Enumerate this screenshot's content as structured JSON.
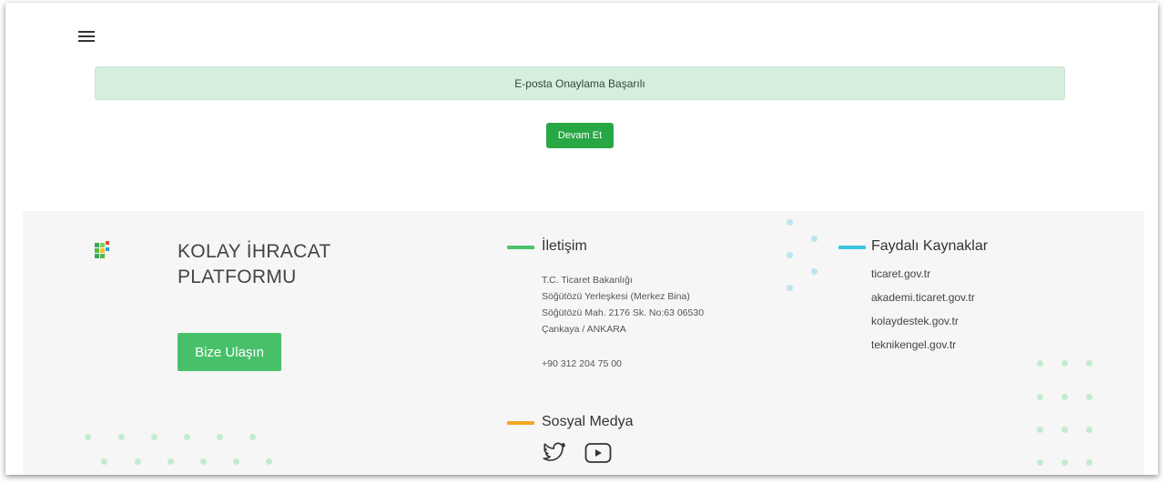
{
  "header": {
    "menu_icon": "hamburger-menu-icon"
  },
  "alert": {
    "text": "E-posta Onaylama Başarılı"
  },
  "continue_button": {
    "label": "Devam Et"
  },
  "footer": {
    "brand": {
      "line1": "KOLAY İHRACAT",
      "line2": "PLATFORMU",
      "logo_icon": "pixel-logo-icon"
    },
    "contact_button": {
      "label": "Bize Ulaşın"
    },
    "contact": {
      "title": "İletişim",
      "address_lines": [
        "T.C. Ticaret Bakanlığı",
        "Söğütözü Yerleşkesi (Merkez Bina)",
        "Söğütözü Mah. 2176 Sk. No:63 06530",
        "Çankaya / ANKARA"
      ],
      "phone": "+90 312 204 75 00"
    },
    "social": {
      "title": "Sosyal Medya",
      "icons": [
        "twitter-icon",
        "youtube-icon"
      ]
    },
    "resources": {
      "title": "Faydalı Kaynaklar",
      "links": [
        "ticaret.gov.tr",
        "akademi.ticaret.gov.tr",
        "kolaydestek.gov.tr",
        "teknikengel.gov.tr"
      ]
    },
    "accent_colors": {
      "contact": "#4cc26d",
      "social": "#f5a623",
      "resources": "#3bc3e0"
    }
  }
}
